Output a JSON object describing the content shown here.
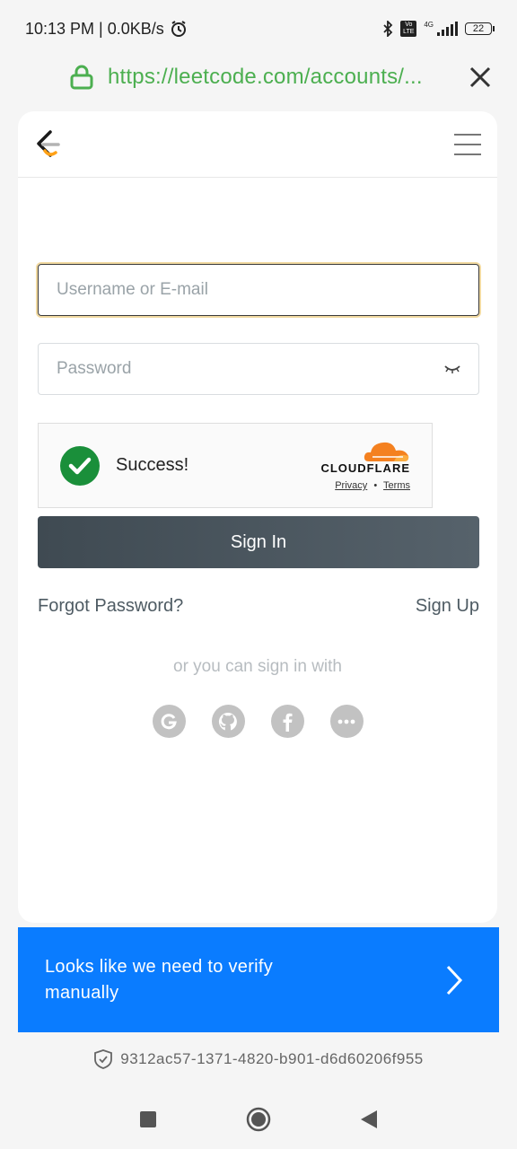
{
  "status": {
    "time": "10:13 PM | 0.0KB/s",
    "network": "4G",
    "volte": "Vo LTE",
    "battery": "22"
  },
  "browser": {
    "url": "https://leetcode.com/accounts/..."
  },
  "form": {
    "username_placeholder": "Username or E-mail",
    "password_placeholder": "Password",
    "sign_in_label": "Sign In",
    "forgot_label": "Forgot Password?",
    "signup_label": "Sign Up",
    "or_text": "or you can sign in with"
  },
  "captcha": {
    "status_text": "Success!",
    "brand": "CLOUDFLARE",
    "privacy": "Privacy",
    "separator": "•",
    "terms": "Terms"
  },
  "social_icons": [
    "google-icon",
    "github-icon",
    "facebook-icon",
    "more-icon"
  ],
  "verify": {
    "text": "Looks like we need to verify manually"
  },
  "ray_id": "9312ac57-1371-4820-b901-d6d60206f955",
  "colors": {
    "url_green": "#4caf50",
    "verify_blue": "#0a7cff",
    "success_green": "#1a8f3a",
    "cloudflare_orange": "#f48120"
  }
}
